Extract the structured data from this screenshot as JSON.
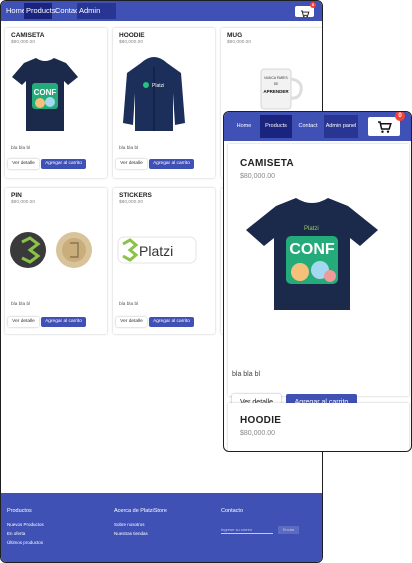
{
  "nav": {
    "links": [
      "Home",
      "Products",
      "Contact",
      "Admin panel"
    ],
    "cart_count": "0"
  },
  "products": [
    {
      "name": "CAMISETA",
      "price": "$80,000.00",
      "description": "bla bla bl"
    },
    {
      "name": "HOODIE",
      "price": "$80,000.00",
      "description": "bla bla bl"
    },
    {
      "name": "MUG",
      "price": "$80,000.00",
      "description": ""
    },
    {
      "name": "PIN",
      "price": "$80,000.00",
      "description": "bla bla bl"
    },
    {
      "name": "STICKERS",
      "price": "$80,000.00",
      "description": "bla bla bl"
    }
  ],
  "card_buttons": {
    "detail": "Ver detalle",
    "add": "Agregar al carrito"
  },
  "images": {
    "shirt_logo": "CONF",
    "shirt_brand": "Platzi",
    "mug_lines": [
      "NUNCA PARES",
      "DE",
      "APRENDER"
    ],
    "sticker_text": "Platzi"
  },
  "footer": {
    "products_heading": "Productos",
    "products_links": [
      "Nuevos Productos",
      "En oferta",
      "Últimos productos"
    ],
    "about_heading": "Acerca de PlatziStore",
    "about_links": [
      "Sobre nosotros",
      "Nuestras tiendas"
    ],
    "contact_heading": "Contacto",
    "email_placeholder": "Ingrese su correo",
    "send_label": "Enviar"
  },
  "colors": {
    "primary": "#3f51b5",
    "nav_active": "#1a237e",
    "badge": "#f44336"
  }
}
